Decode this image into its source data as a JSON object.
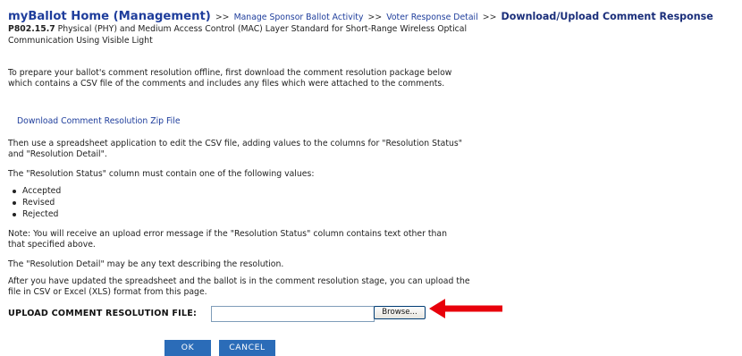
{
  "breadcrumb": {
    "home": "myBallot Home (Management)",
    "sep": ">>",
    "manage": "Manage Sponsor Ballot Activity",
    "voter": "Voter Response Detail",
    "current": "Download/Upload Comment Response"
  },
  "standard": {
    "id": "P802.15.7",
    "title": "Physical (PHY) and Medium Access Control (MAC) Layer Standard for Short-Range Wireless Optical Communication Using Visible Light"
  },
  "content": {
    "intro": "To prepare your ballot's comment resolution offline, first download the comment resolution package below which contains a CSV file of the comments and includes any files which were attached to the comments.",
    "download_link": "Download Comment Resolution Zip File",
    "edit_instructions": "Then use a spreadsheet application to edit the CSV file, adding values to the columns for \"Resolution Status\" and \"Resolution Detail\".",
    "status_values_intro": "The \"Resolution Status\" column must contain one of the following values:",
    "status_values": [
      "Accepted",
      "Revised",
      "Rejected"
    ],
    "note": "Note: You will receive an upload error message if the \"Resolution Status\" column contains text other than that specified above.",
    "detail_note": "The \"Resolution Detail\" may be any text describing the resolution.",
    "upload_instructions": "After you have updated the spreadsheet and the ballot is in the comment resolution stage, you can upload the file in CSV or Excel (XLS) format from this page."
  },
  "upload": {
    "label": "UPLOAD COMMENT RESOLUTION FILE:",
    "value": "",
    "browse_label": "Browse..."
  },
  "actions": {
    "ok_label": "OK",
    "cancel_label": "CANCEL"
  },
  "colors": {
    "link": "#1f3e9c",
    "button": "#2b6cb8",
    "annotation_arrow": "#e8000b"
  }
}
